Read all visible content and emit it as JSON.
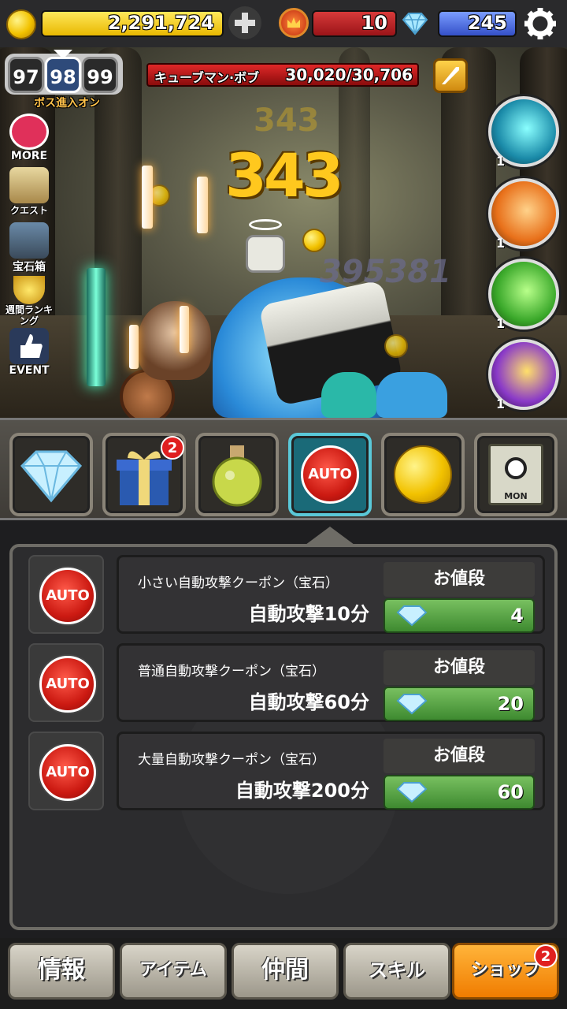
{
  "header": {
    "gold": "2,291,724",
    "level": "10",
    "gems": "245"
  },
  "stage": {
    "prev": "97",
    "current": "98",
    "next": "99",
    "boss_label": "ボス進入オン"
  },
  "boss": {
    "name": "キューブマン·ボブ",
    "hp": "30,020/30,706"
  },
  "battle": {
    "damage": "343",
    "damage_faded": "343",
    "damage_total": "395381"
  },
  "side_menu": {
    "more": "MORE",
    "quest": "クエスト",
    "gem_box": "宝石箱",
    "weekly_ranking": "週間ランキング",
    "event": "EVENT"
  },
  "allies": [
    {
      "count": "1"
    },
    {
      "count": "1"
    },
    {
      "count": "1"
    },
    {
      "count": "1"
    }
  ],
  "item_bar": {
    "gift_badge": "2",
    "auto_label": "AUTO",
    "mon_label": "MON"
  },
  "shop": {
    "auto_label": "AUTO",
    "price_header": "お値段",
    "items": [
      {
        "title": "小さい自動攻撃クーポン（宝石）",
        "desc": "自動攻撃10分",
        "price": "4"
      },
      {
        "title": "普通自動攻撃クーポン（宝石）",
        "desc": "自動攻撃60分",
        "price": "20"
      },
      {
        "title": "大量自動攻撃クーポン（宝石）",
        "desc": "自動攻撃200分",
        "price": "60"
      }
    ]
  },
  "tabs": {
    "info": "情報",
    "item": "アイテム",
    "party": "仲間",
    "skill": "スキル",
    "shop": "ショップ",
    "shop_badge": "2"
  },
  "colors": {
    "gold_bar": "#f5d21a",
    "level_bar": "#c8242c",
    "gem_bar": "#4a6ee0",
    "price_green": "#5aa845",
    "shop_tab": "#ff9a10"
  }
}
